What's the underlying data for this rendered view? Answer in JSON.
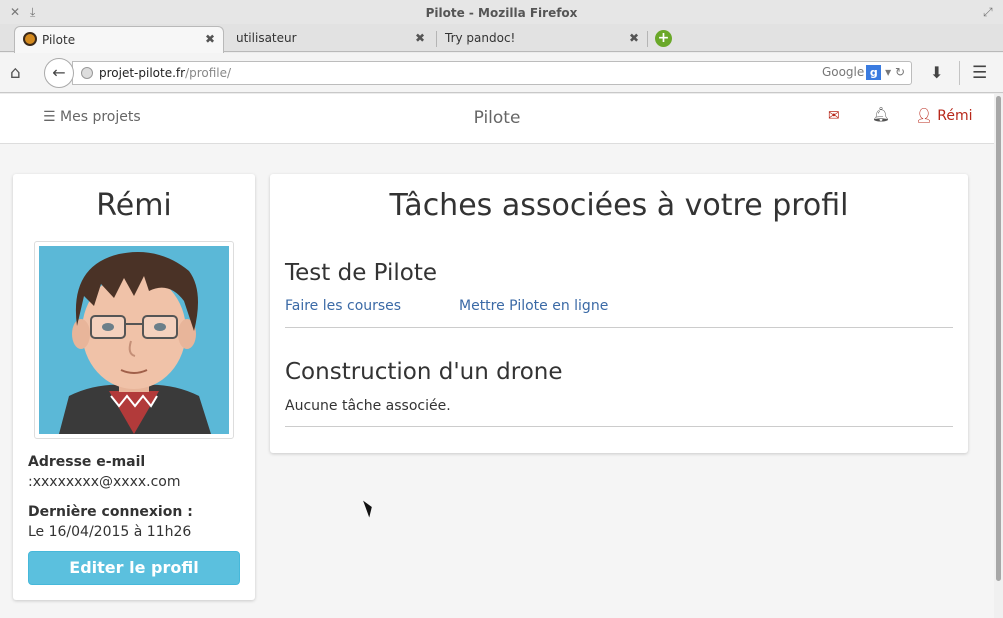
{
  "window": {
    "title": "Pilote - Mozilla Firefox"
  },
  "tabs": [
    {
      "label": "Pilote",
      "active": true
    },
    {
      "label": "utilisateur",
      "active": false
    },
    {
      "label": "Try pandoc!",
      "active": false
    }
  ],
  "navbar": {
    "url_host": "projet-pilote.fr",
    "url_path": "/profile/",
    "search_engine": "Google"
  },
  "site": {
    "projects_label": "Mes projets",
    "brand": "Pilote",
    "user_label": "Rémi"
  },
  "profile": {
    "name": "Rémi",
    "email_label": "Adresse e-mail",
    "email_value": ":xxxxxxxx@xxxx.com",
    "last_login_label": "Dernière connexion :",
    "last_login_value": "Le 16/04/2015 à 11h26",
    "edit_button": "Editer le profil"
  },
  "tasks": {
    "heading": "Tâches associées à votre profil",
    "projects": [
      {
        "name": "Test de Pilote",
        "tasks": [
          "Faire les courses",
          "Mettre Pilote en ligne"
        ],
        "empty_text": ""
      },
      {
        "name": "Construction d'un drone",
        "tasks": [],
        "empty_text": "Aucune tâche associée."
      }
    ]
  },
  "colors": {
    "accent_red": "#b8281b",
    "link": "#3b6aa6",
    "button": "#5bc0de"
  }
}
